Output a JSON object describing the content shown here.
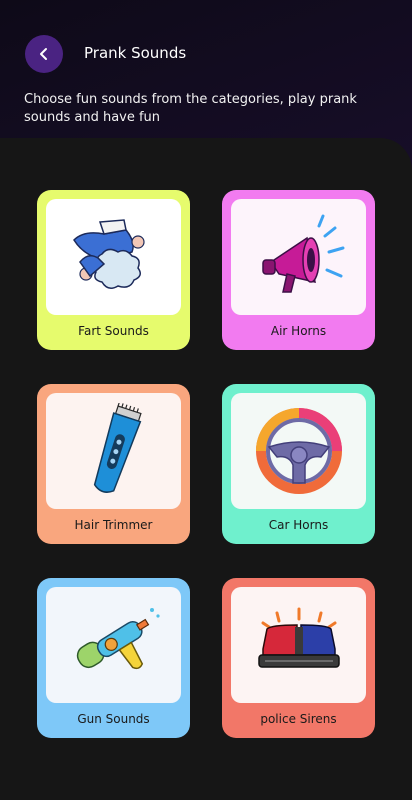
{
  "header": {
    "title": "Prank Sounds",
    "subtitle": "Choose fun sounds from the categories, play prank sounds and have fun",
    "back_icon": "chevron-left-icon"
  },
  "cards": [
    {
      "label": "Fart Sounds",
      "icon": "fart-icon",
      "color": "#e6fb6d",
      "inner": "#ffffff"
    },
    {
      "label": "Air Horns",
      "icon": "megaphone-icon",
      "color": "#f27bf0",
      "inner": "#fdf4fb"
    },
    {
      "label": "Hair Trimmer",
      "icon": "trimmer-icon",
      "color": "#f9a67e",
      "inner": "#fdf3f0"
    },
    {
      "label": "Car Horns",
      "icon": "steering-wheel-icon",
      "color": "#6ff0cd",
      "inner": "#f3f9f6"
    },
    {
      "label": "Gun Sounds",
      "icon": "water-gun-icon",
      "color": "#7ec8f8",
      "inner": "#f2f6fb"
    },
    {
      "label": "police Sirens",
      "icon": "siren-icon",
      "color": "#f27768",
      "inner": "#fdf4f3"
    }
  ]
}
